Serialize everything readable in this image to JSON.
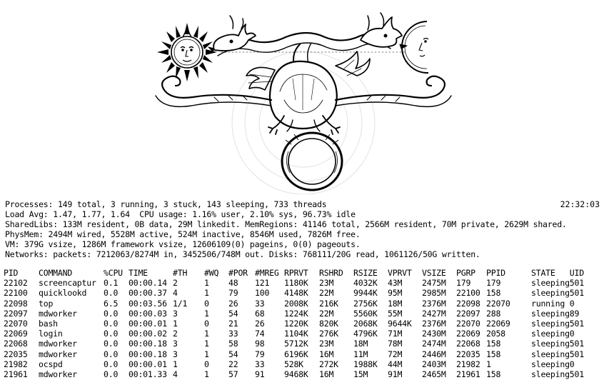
{
  "summary": {
    "processes": "Processes: 149 total, 3 running, 3 stuck, 143 sleeping, 733 threads",
    "clock": "22:32:03",
    "load": "Load Avg: 1.47, 1.77, 1.64  CPU usage: 1.16% user, 2.10% sys, 96.73% idle",
    "shared": "SharedLibs: 133M resident, 0B data, 29M linkedit. MemRegions: 41146 total, 2566M resident, 70M private, 2629M shared.",
    "physmem": "PhysMem: 2494M wired, 5528M active, 524M inactive, 8546M used, 7826M free.",
    "vm": "VM: 379G vsize, 1286M framework vsize, 12606109(0) pageins, 0(0) pageouts.",
    "networks": "Networks: packets: 7212063/8274M in, 3452506/748M out. Disks: 768111/20G read, 1061126/50G written."
  },
  "table": {
    "headers": [
      "PID",
      "COMMAND",
      "%CPU",
      "TIME",
      "#TH",
      "#WQ",
      "#POR",
      "#MREG",
      "RPRVT",
      "RSHRD",
      "RSIZE",
      "VPRVT",
      "VSIZE",
      "PGRP",
      "PPID",
      "STATE",
      "UID"
    ],
    "rows": [
      [
        "22102",
        "screencaptur",
        "0.1",
        "00:00.14",
        "2",
        "1",
        "48",
        "121",
        "1180K",
        "23M",
        "4032K",
        "43M",
        "2475M",
        "179",
        "179",
        "sleeping",
        "501"
      ],
      [
        "22100",
        "quicklookd",
        "0.0",
        "00:00.37",
        "4",
        "1",
        "79",
        "100",
        "4148K",
        "22M",
        "9944K",
        "95M",
        "2985M",
        "22100",
        "158",
        "sleeping",
        "501"
      ],
      [
        "22098",
        "top",
        "6.5",
        "00:03.56",
        "1/1",
        "0",
        "26",
        "33",
        "2008K",
        "216K",
        "2756K",
        "18M",
        "2376M",
        "22098",
        "22070",
        "running",
        "0"
      ],
      [
        "22097",
        "mdworker",
        "0.0",
        "00:00.03",
        "3",
        "1",
        "54",
        "68",
        "1224K",
        "22M",
        "5560K",
        "55M",
        "2427M",
        "22097",
        "288",
        "sleeping",
        "89"
      ],
      [
        "22070",
        "bash",
        "0.0",
        "00:00.01",
        "1",
        "0",
        "21",
        "26",
        "1220K",
        "820K",
        "2068K",
        "9644K",
        "2376M",
        "22070",
        "22069",
        "sleeping",
        "501"
      ],
      [
        "22069",
        "login",
        "0.0",
        "00:00.02",
        "2",
        "1",
        "33",
        "74",
        "1104K",
        "276K",
        "4796K",
        "71M",
        "2430M",
        "22069",
        "2058",
        "sleeping",
        "0"
      ],
      [
        "22068",
        "mdworker",
        "0.0",
        "00:00.18",
        "3",
        "1",
        "58",
        "98",
        "5712K",
        "23M",
        "18M",
        "78M",
        "2474M",
        "22068",
        "158",
        "sleeping",
        "501"
      ],
      [
        "22035",
        "mdworker",
        "0.0",
        "00:00.18",
        "3",
        "1",
        "54",
        "79",
        "6196K",
        "16M",
        "11M",
        "72M",
        "2446M",
        "22035",
        "158",
        "sleeping",
        "501"
      ],
      [
        "21982",
        "ocspd",
        "0.0",
        "00:00.01",
        "1",
        "0",
        "22",
        "33",
        "528K",
        "272K",
        "1988K",
        "44M",
        "2403M",
        "21982",
        "1",
        "sleeping",
        "0"
      ],
      [
        "21961",
        "mdworker",
        "0.0",
        "00:01.33",
        "4",
        "1",
        "57",
        "91",
        "9468K",
        "16M",
        "15M",
        "91M",
        "2465M",
        "21961",
        "158",
        "sleeping",
        "501"
      ]
    ]
  },
  "illustration": {
    "icons": [
      "sun-face-icon",
      "moon-face-icon",
      "dragon-icon",
      "ring-icon"
    ],
    "ink_color": "#000000",
    "watermark_color": "#e6e6e6"
  }
}
